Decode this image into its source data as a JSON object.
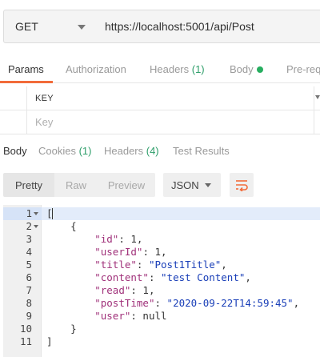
{
  "request": {
    "method": "GET",
    "url": "https://localhost:5001/api/Post"
  },
  "request_tabs": [
    {
      "label": "Params",
      "active": true
    },
    {
      "label": "Authorization"
    },
    {
      "label": "Headers ",
      "count": "(1)"
    },
    {
      "label": "Body"
    },
    {
      "label": "Pre-req"
    }
  ],
  "params": {
    "header_key": "KEY",
    "key_placeholder": "Key"
  },
  "response_tabs": [
    {
      "label": "Body",
      "active": true
    },
    {
      "label": "Cookies ",
      "count": "(1)"
    },
    {
      "label": "Headers ",
      "count": "(4)"
    },
    {
      "label": "Test Results"
    }
  ],
  "toolbar": {
    "pretty": "Pretty",
    "raw": "Raw",
    "preview": "Preview",
    "format": "JSON",
    "wrap_icon": "wrap-lines-icon"
  },
  "colors": {
    "accent_orange": "#f26b3a",
    "count_green": "#2e9e6a",
    "key_color": "#a0317a",
    "string_color": "#1a3fb8"
  },
  "response_body": {
    "line_numbers": [
      "1",
      "2",
      "3",
      "4",
      "5",
      "6",
      "7",
      "8",
      "9",
      "10",
      "11"
    ],
    "lines": [
      [
        {
          "t": "["
        }
      ],
      [
        {
          "t": "    {"
        }
      ],
      [
        {
          "t": "        "
        },
        {
          "t": "\"id\"",
          "c": "k"
        },
        {
          "t": ": 1,"
        }
      ],
      [
        {
          "t": "        "
        },
        {
          "t": "\"userId\"",
          "c": "k"
        },
        {
          "t": ": 1,"
        }
      ],
      [
        {
          "t": "        "
        },
        {
          "t": "\"title\"",
          "c": "k"
        },
        {
          "t": ": "
        },
        {
          "t": "\"Post1Title\"",
          "c": "s"
        },
        {
          "t": ","
        }
      ],
      [
        {
          "t": "        "
        },
        {
          "t": "\"content\"",
          "c": "k"
        },
        {
          "t": ": "
        },
        {
          "t": "\"test Content\"",
          "c": "s"
        },
        {
          "t": ","
        }
      ],
      [
        {
          "t": "        "
        },
        {
          "t": "\"read\"",
          "c": "k"
        },
        {
          "t": ": 1,"
        }
      ],
      [
        {
          "t": "        "
        },
        {
          "t": "\"postTime\"",
          "c": "k"
        },
        {
          "t": ": "
        },
        {
          "t": "\"2020-09-22T14:59:45\"",
          "c": "s"
        },
        {
          "t": ","
        }
      ],
      [
        {
          "t": "        "
        },
        {
          "t": "\"user\"",
          "c": "k"
        },
        {
          "t": ": null"
        }
      ],
      [
        {
          "t": "    }"
        }
      ],
      [
        {
          "t": "]"
        }
      ]
    ]
  }
}
